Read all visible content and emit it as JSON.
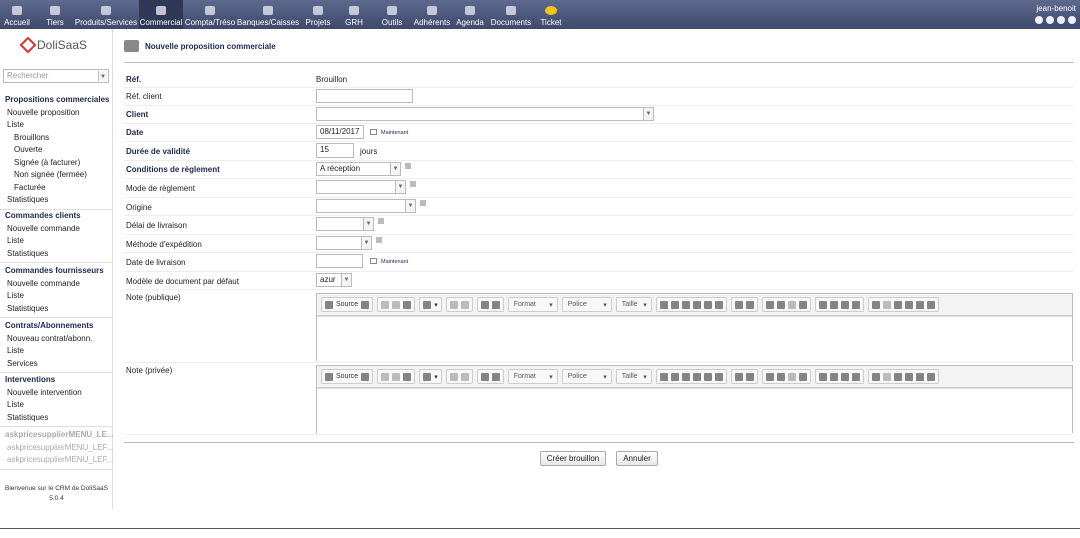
{
  "topmenu": [
    {
      "label": "Accueil",
      "icon": "home-icon"
    },
    {
      "label": "Tiers",
      "icon": "company-icon"
    },
    {
      "label": "Produits/Services",
      "icon": "products-icon"
    },
    {
      "label": "Commercial",
      "icon": "commercial-icon"
    },
    {
      "label": "Compta/Tréso",
      "icon": "accounting-icon"
    },
    {
      "label": "Banques/Caisses",
      "icon": "bank-icon"
    },
    {
      "label": "Projets",
      "icon": "projects-icon"
    },
    {
      "label": "GRH",
      "icon": "hr-icon"
    },
    {
      "label": "Outils",
      "icon": "tools-icon"
    },
    {
      "label": "Adhérents",
      "icon": "members-icon"
    },
    {
      "label": "Agenda",
      "icon": "agenda-icon"
    },
    {
      "label": "Documents",
      "icon": "documents-icon"
    },
    {
      "label": "Ticket",
      "icon": "ticket-icon"
    }
  ],
  "user": {
    "name": "jean-benoit"
  },
  "sidebar": {
    "logo": "DoliSaaS",
    "search_placeholder": "Rechercher",
    "sections": [
      {
        "title": "Propositions commerciales",
        "items": [
          "Nouvelle proposition",
          "Liste"
        ],
        "sub": [
          "Brouillons",
          "Ouverte",
          "Signée (à facturer)",
          "Non signée (fermée)",
          "Facturée"
        ],
        "extra": [
          "Statistiques"
        ]
      },
      {
        "title": "Commandes clients",
        "items": [
          "Nouvelle commande",
          "Liste",
          "Statistiques"
        ]
      },
      {
        "title": "Commandes fournisseurs",
        "items": [
          "Nouvelle commande",
          "Liste",
          "Statistiques"
        ]
      },
      {
        "title": "Contrats/Abonnements",
        "items": [
          "Nouveau contrat/abonn.",
          "Liste",
          "Services"
        ]
      },
      {
        "title": "Interventions",
        "items": [
          "Nouvelle intervention",
          "Liste",
          "Statistiques"
        ]
      }
    ],
    "grey": [
      "askpricesupplierMENU_LE...",
      "askpricesupplierMENU_LEF...",
      "askpricesupplierMENU_LEF..."
    ],
    "welcome": "Bienvenue sur le CRM de DoliSaaS",
    "version": "5.0.4"
  },
  "page": {
    "title": "Nouvelle proposition commerciale",
    "ref_label": "Réf.",
    "ref_value": "Brouillon",
    "refclient_label": "Réf. client",
    "client_label": "Client",
    "date_label": "Date",
    "date_value": "08/11/2017",
    "now_label": "Maintenant",
    "validity_label": "Durée de validité",
    "validity_value": "15",
    "validity_unit": "jours",
    "conditions_label": "Conditions de règlement",
    "conditions_value": "A réception",
    "mode_label": "Mode de règlement",
    "origin_label": "Origine",
    "delay_label": "Délai de livraison",
    "shipping_label": "Méthode d'expédition",
    "delivery_label": "Date de livraison",
    "model_label": "Modèle de document par défaut",
    "model_value": "azur",
    "note_public_label": "Note (publique)",
    "note_private_label": "Note (privée)",
    "editor": {
      "source": "Source",
      "format": "Format",
      "font": "Police",
      "size": "Taille"
    },
    "create_button": "Créer brouillon",
    "cancel_button": "Annuler"
  }
}
